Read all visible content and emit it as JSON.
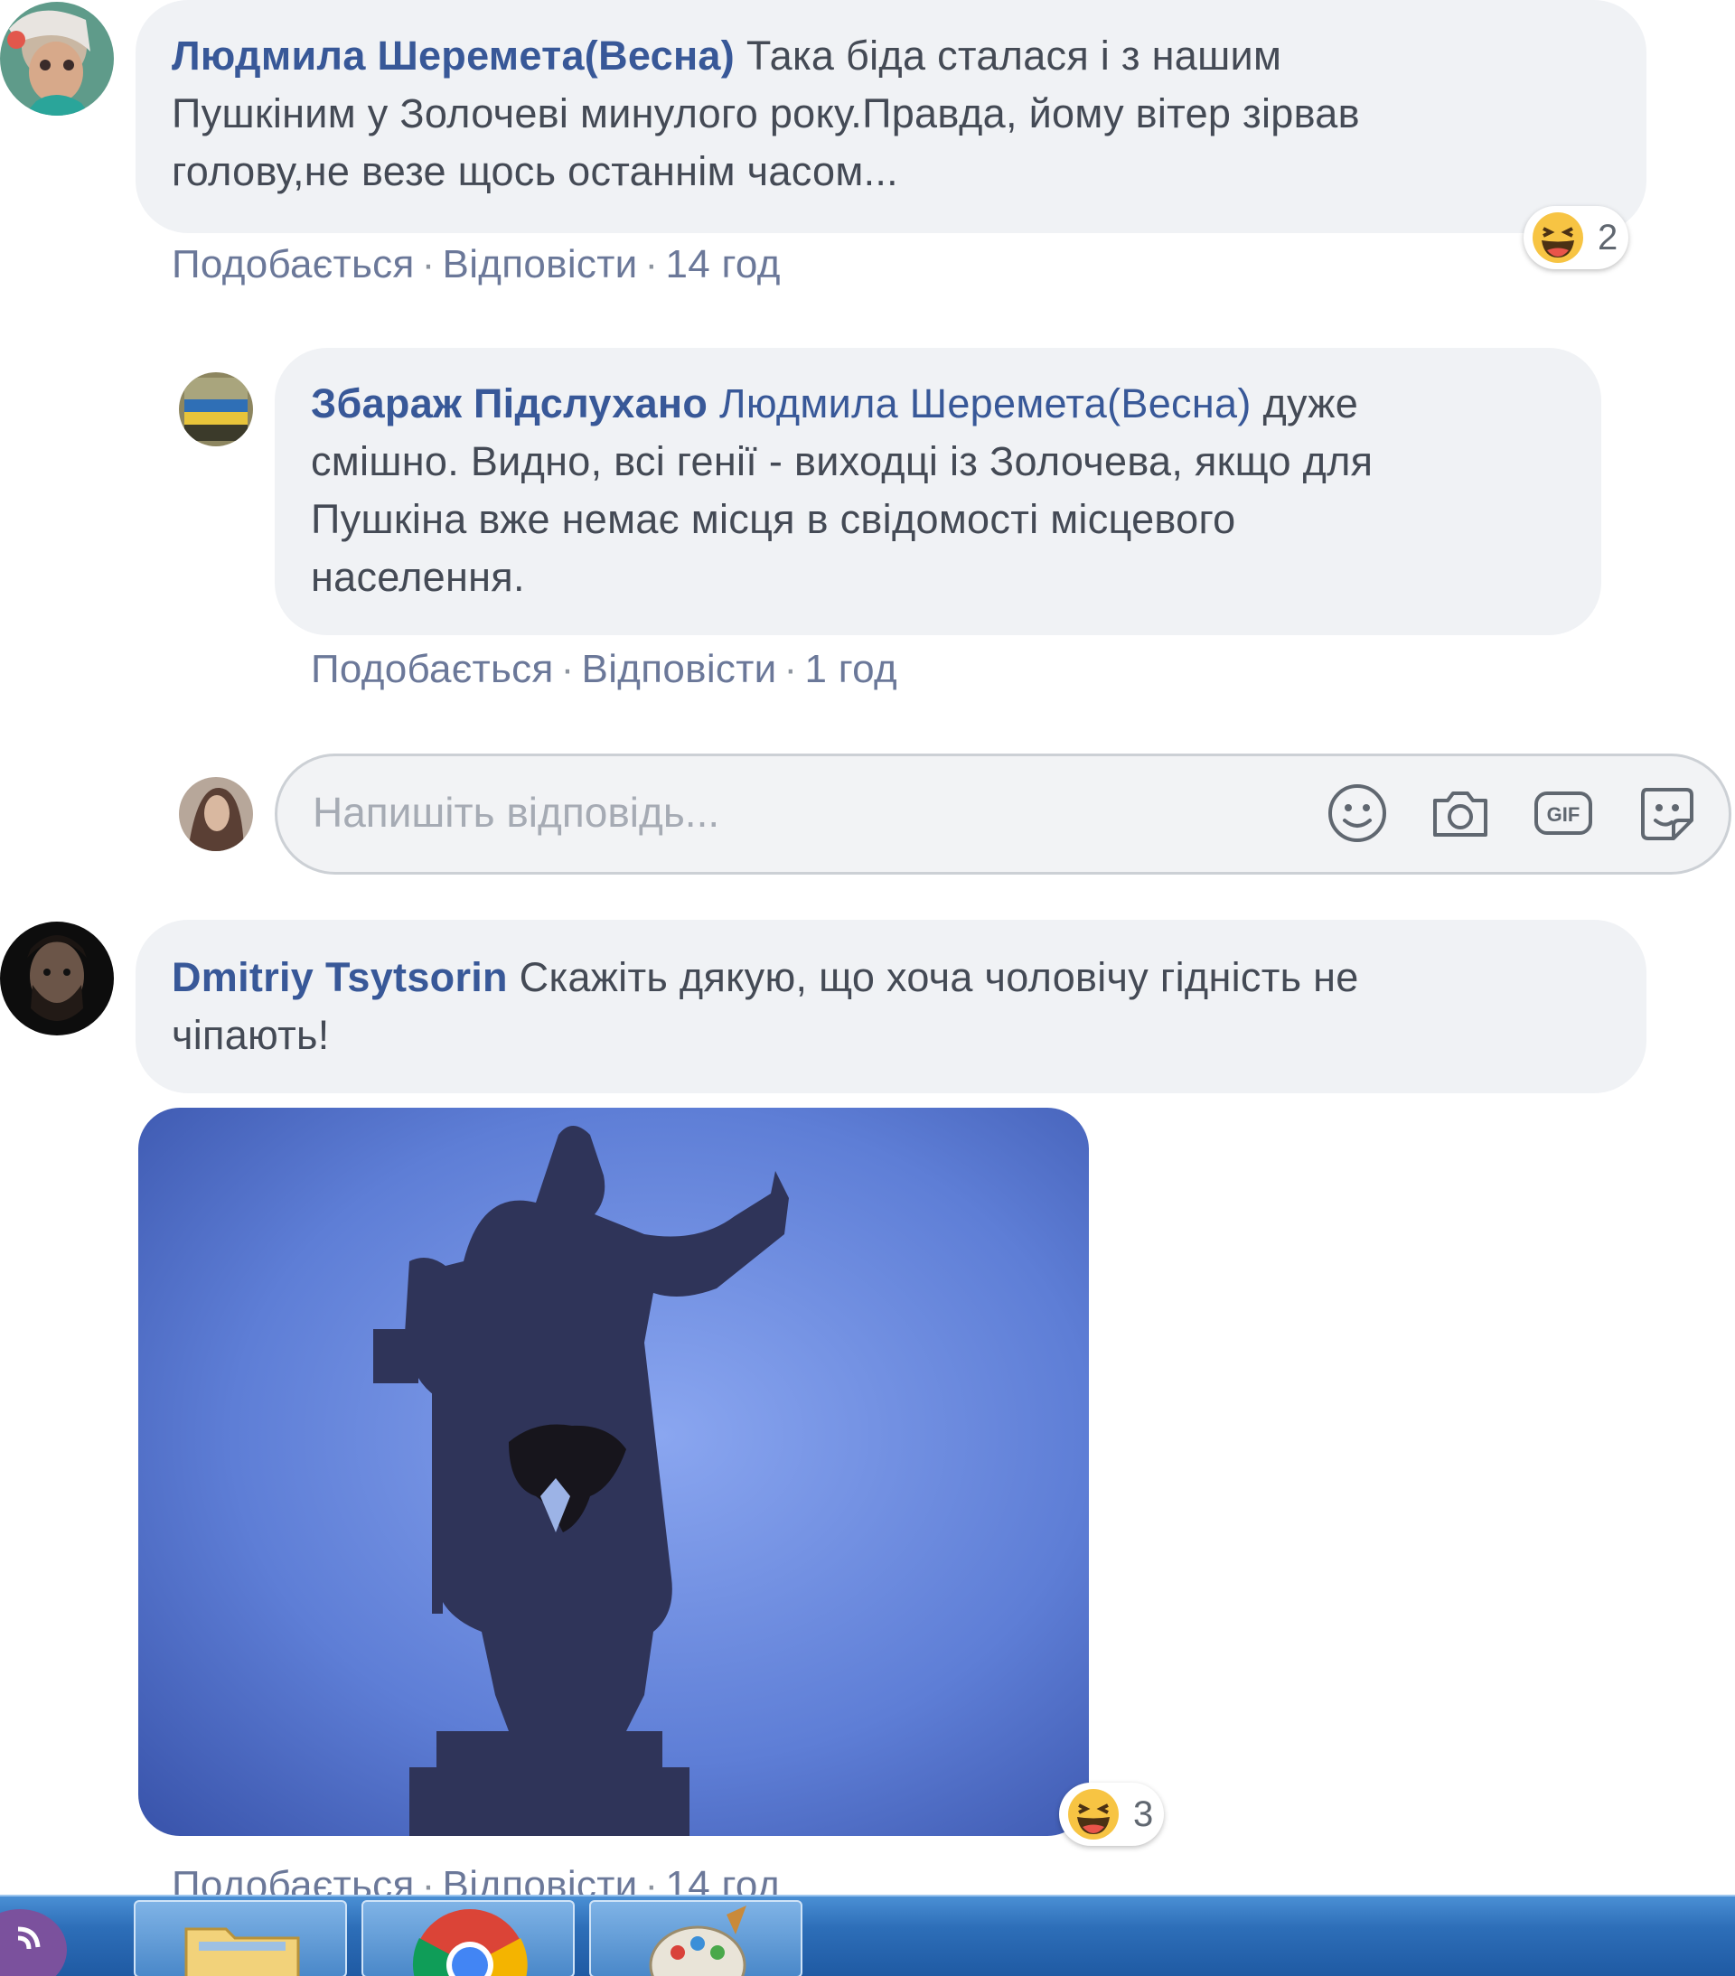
{
  "comments": [
    {
      "author": "Людмила Шеремета(Весна)",
      "lines": [
        "Така біда сталася і з нашим",
        "Пушкіним у Золочеві минулого року.Правда, йому вітер зірвав",
        "голову,не везе щось останнім часом..."
      ],
      "reaction_count": "2",
      "reaction_icon": "haha-icon",
      "actions": {
        "like": "Подобається",
        "reply": "Відповісти",
        "time": "14 год"
      }
    },
    {
      "author": "Збараж Підслухано",
      "mention": "Людмила Шеремета(Весна)",
      "lines": [
        "дуже",
        "смішно. Видно, всі генії - виходці із Золочева, якщо для",
        "Пушкіна вже немає місця в свідомості місцевого",
        "населення."
      ],
      "actions": {
        "like": "Подобається",
        "reply": "Відповісти",
        "time": "1 год"
      }
    },
    {
      "author": "Dmitriy Tsytsorin",
      "lines": [
        "Скажіть дякую, що хоча чоловічу гідність не",
        "чіпають!"
      ],
      "reaction_count": "3",
      "reaction_icon": "haha-icon",
      "actions": {
        "like": "Подобається",
        "reply": "Відповісти",
        "time": "14 год"
      }
    }
  ],
  "reply_box": {
    "placeholder": "Напишіть відповідь...",
    "icons": [
      "emoji-icon",
      "camera-icon",
      "gif-icon",
      "sticker-icon"
    ]
  },
  "taskbar": {
    "items": [
      "viber-icon",
      "file-explorer-icon",
      "chrome-icon",
      "paint-icon"
    ]
  },
  "colors": {
    "author": "#385898",
    "bubble": "#f0f2f5",
    "taskbar": "#2d6eb8"
  }
}
